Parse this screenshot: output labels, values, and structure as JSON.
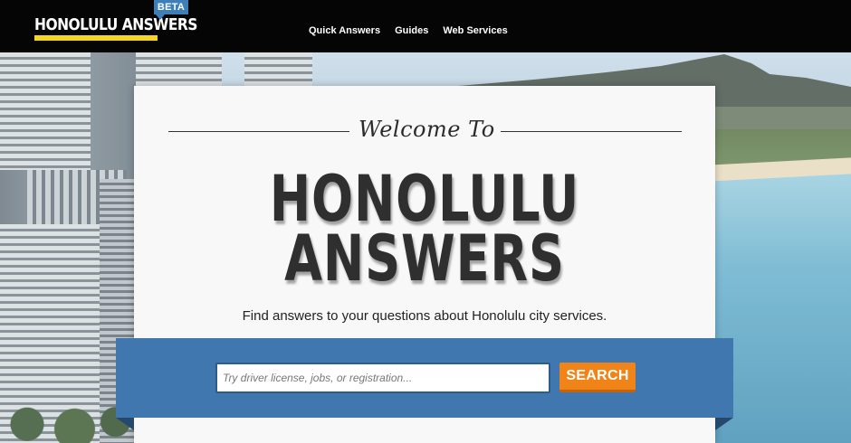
{
  "header": {
    "logo_text": "HONOLULU ANSWERS",
    "beta_badge": "BETA",
    "nav": [
      {
        "label": "Quick Answers"
      },
      {
        "label": "Guides"
      },
      {
        "label": "Web Services"
      }
    ]
  },
  "hero": {
    "welcome": "Welcome To",
    "title_line1": "HONOLULU",
    "title_line2": "ANSWERS",
    "subtitle": "Find answers to your questions about Honolulu city services."
  },
  "search": {
    "placeholder": "Try driver license, jobs, or registration...",
    "value": "",
    "button_label": "SEARCH"
  },
  "colors": {
    "topbar": "#050505",
    "logo_underline": "#f4d51f",
    "beta_badge": "#3e7fb8",
    "search_band": "#4077ae",
    "search_button": "#f08418"
  }
}
